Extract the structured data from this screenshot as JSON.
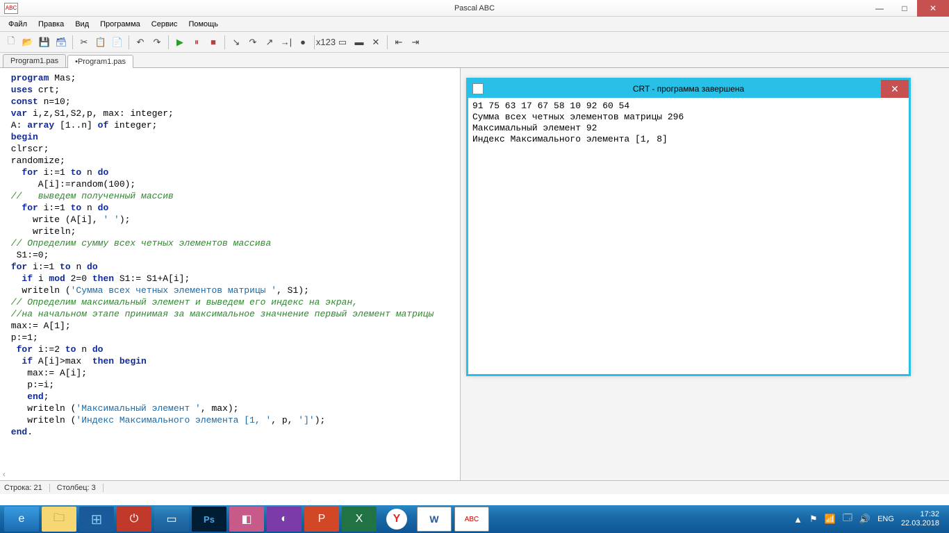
{
  "window": {
    "title": "Pascal ABC",
    "icon_label": "ABC"
  },
  "menu": {
    "items": [
      "Файл",
      "Правка",
      "Вид",
      "Программа",
      "Сервис",
      "Помощь"
    ]
  },
  "toolbar": {
    "icons": [
      {
        "name": "new-file-icon",
        "glyph": "🗋",
        "cls": "new"
      },
      {
        "name": "open-file-icon",
        "glyph": "📂",
        "cls": "open"
      },
      {
        "name": "save-icon",
        "glyph": "💾",
        "cls": "save"
      },
      {
        "name": "save-all-icon",
        "glyph": "🗃",
        "cls": "save"
      },
      {
        "sep": true
      },
      {
        "name": "cut-icon",
        "glyph": "✂",
        "cls": ""
      },
      {
        "name": "copy-icon",
        "glyph": "📋",
        "cls": ""
      },
      {
        "name": "paste-icon",
        "glyph": "📄",
        "cls": ""
      },
      {
        "sep": true
      },
      {
        "name": "undo-icon",
        "glyph": "↶",
        "cls": ""
      },
      {
        "name": "redo-icon",
        "glyph": "↷",
        "cls": ""
      },
      {
        "sep": true
      },
      {
        "name": "run-icon",
        "glyph": "▶",
        "cls": "run"
      },
      {
        "name": "pause-icon",
        "glyph": "⏸",
        "cls": "stop"
      },
      {
        "name": "stop-icon",
        "glyph": "■",
        "cls": "stop"
      },
      {
        "sep": true
      },
      {
        "name": "step-into-icon",
        "glyph": "↘",
        "cls": ""
      },
      {
        "name": "step-over-icon",
        "glyph": "↷",
        "cls": ""
      },
      {
        "name": "step-out-icon",
        "glyph": "↗",
        "cls": ""
      },
      {
        "name": "run-to-cursor-icon",
        "glyph": "→|",
        "cls": ""
      },
      {
        "name": "breakpoint-icon",
        "glyph": "●",
        "cls": ""
      },
      {
        "sep": true
      },
      {
        "name": "watch-icon",
        "glyph": "x123",
        "cls": ""
      },
      {
        "name": "window-icon",
        "glyph": "▭",
        "cls": ""
      },
      {
        "name": "console-icon",
        "glyph": "▬",
        "cls": ""
      },
      {
        "name": "clear-icon",
        "glyph": "✕",
        "cls": ""
      },
      {
        "sep": true
      },
      {
        "name": "indent-left-icon",
        "glyph": "⇤",
        "cls": ""
      },
      {
        "name": "indent-right-icon",
        "glyph": "⇥",
        "cls": ""
      }
    ]
  },
  "tabs": [
    {
      "label": "Program1.pas",
      "active": false
    },
    {
      "label": "•Program1.pas",
      "active": true
    }
  ],
  "code": {
    "lines": [
      {
        "t": " program",
        "c": "kw"
      },
      {
        "t": " Mas;\n"
      },
      {
        "t": " uses",
        "c": "kw"
      },
      {
        "t": " crt;\n"
      },
      {
        "t": " const",
        "c": "kw"
      },
      {
        "t": " n=10;\n"
      },
      {
        "t": " var",
        "c": "kw"
      },
      {
        "t": " i,z,S1,S2,p, max: integer;\n"
      },
      {
        "t": " A: "
      },
      {
        "t": "array",
        "c": "kw"
      },
      {
        "t": " [1..n] "
      },
      {
        "t": "of",
        "c": "kw"
      },
      {
        "t": " integer;\n"
      },
      {
        "t": " begin",
        "c": "kw"
      },
      {
        "t": "\n"
      },
      {
        "t": " clrscr;\n"
      },
      {
        "t": " randomize;\n"
      },
      {
        "t": "   "
      },
      {
        "t": "for",
        "c": "kw"
      },
      {
        "t": " i:=1 "
      },
      {
        "t": "to",
        "c": "kw"
      },
      {
        "t": " n "
      },
      {
        "t": "do",
        "c": "kw"
      },
      {
        "t": "\n"
      },
      {
        "t": "      A[i]:=random(100);\n"
      },
      {
        "t": " //   выведем полученный массив",
        "c": "cmt"
      },
      {
        "t": "\n"
      },
      {
        "t": "   "
      },
      {
        "t": "for",
        "c": "kw"
      },
      {
        "t": " i:=1 "
      },
      {
        "t": "to",
        "c": "kw"
      },
      {
        "t": " n "
      },
      {
        "t": "do",
        "c": "kw"
      },
      {
        "t": "\n"
      },
      {
        "t": "     write (A[i], "
      },
      {
        "t": "' '",
        "c": "str"
      },
      {
        "t": ");\n"
      },
      {
        "t": "     writeln;\n"
      },
      {
        "t": " // Определим сумму всех четных элементов массива",
        "c": "cmt"
      },
      {
        "t": "\n"
      },
      {
        "t": "  S1:=0;\n"
      },
      {
        "t": " "
      },
      {
        "t": "for",
        "c": "kw"
      },
      {
        "t": " i:=1 "
      },
      {
        "t": "to",
        "c": "kw"
      },
      {
        "t": " n "
      },
      {
        "t": "do",
        "c": "kw"
      },
      {
        "t": "\n"
      },
      {
        "t": "   "
      },
      {
        "t": "if",
        "c": "kw"
      },
      {
        "t": " i "
      },
      {
        "t": "mod",
        "c": "kw"
      },
      {
        "t": " 2=0 "
      },
      {
        "t": "then",
        "c": "kw"
      },
      {
        "t": " S1:= S1+A[i];\n"
      },
      {
        "t": "   writeln ("
      },
      {
        "t": "'Сумма всех четных элементов матрицы '",
        "c": "str"
      },
      {
        "t": ", S1);\n"
      },
      {
        "t": " // Определим максимальный элемент и выведем его индекс на экран,",
        "c": "cmt"
      },
      {
        "t": "\n"
      },
      {
        "t": " //на начальном этапе принимая за максимальное значнение первый элемент матрицы",
        "c": "cmt"
      },
      {
        "t": "\n"
      },
      {
        "t": " max:= A[1];\n"
      },
      {
        "t": " p:=1;\n"
      },
      {
        "t": "  "
      },
      {
        "t": "for",
        "c": "kw"
      },
      {
        "t": " i:=2 "
      },
      {
        "t": "to",
        "c": "kw"
      },
      {
        "t": " n "
      },
      {
        "t": "do",
        "c": "kw"
      },
      {
        "t": "\n"
      },
      {
        "t": "   "
      },
      {
        "t": "if",
        "c": "kw"
      },
      {
        "t": " A[i]>max  "
      },
      {
        "t": "then begin",
        "c": "kw"
      },
      {
        "t": "\n"
      },
      {
        "t": "    max:= A[i];\n"
      },
      {
        "t": "    p:=i;\n"
      },
      {
        "t": "    "
      },
      {
        "t": "end",
        "c": "kw"
      },
      {
        "t": ";\n"
      },
      {
        "t": "    writeln ("
      },
      {
        "t": "'Максимальный элемент '",
        "c": "str"
      },
      {
        "t": ", max);\n"
      },
      {
        "t": "    writeln ("
      },
      {
        "t": "'Индекс Максимального элемента [1, '",
        "c": "str"
      },
      {
        "t": ", p, "
      },
      {
        "t": "']'",
        "c": "str"
      },
      {
        "t": ");\n"
      },
      {
        "t": " end",
        "c": "kw"
      },
      {
        "t": ".\n"
      }
    ]
  },
  "crt": {
    "title": "CRT - программа завершена",
    "output": "91 75 63 17 67 58 10 92 60 54\nСумма всех четных элементов матрицы 296\nМаксимальный элемент 92\nИндекс Максимального элемента [1, 8]"
  },
  "status": {
    "line_label": "Строка:",
    "line": "21",
    "col_label": "Столбец:",
    "col": "3"
  },
  "taskbar": {
    "items": [
      {
        "name": "ie",
        "glyph": "e",
        "cls": "ie"
      },
      {
        "name": "explorer",
        "glyph": "🗀",
        "cls": "explorer"
      },
      {
        "name": "start",
        "glyph": "⊞",
        "cls": "start"
      },
      {
        "name": "power",
        "glyph": "⏻",
        "cls": "red"
      },
      {
        "name": "generic1",
        "glyph": "▭",
        "cls": ""
      },
      {
        "name": "photoshop",
        "glyph": "Ps",
        "cls": "ps"
      },
      {
        "name": "app-pink",
        "glyph": "◧",
        "cls": "pink"
      },
      {
        "name": "app-violet",
        "glyph": "◐",
        "cls": "violet"
      },
      {
        "name": "powerpoint",
        "glyph": "P",
        "cls": "pp"
      },
      {
        "name": "excel",
        "glyph": "X",
        "cls": "xl"
      },
      {
        "name": "yandex",
        "glyph": "Y",
        "cls": "y"
      },
      {
        "name": "word",
        "glyph": "W",
        "cls": "word"
      },
      {
        "name": "pascal-abc",
        "glyph": "ABC",
        "cls": "abc"
      }
    ],
    "tray": {
      "lang": "ENG",
      "time": "17:32",
      "date": "22.03.2018"
    }
  }
}
